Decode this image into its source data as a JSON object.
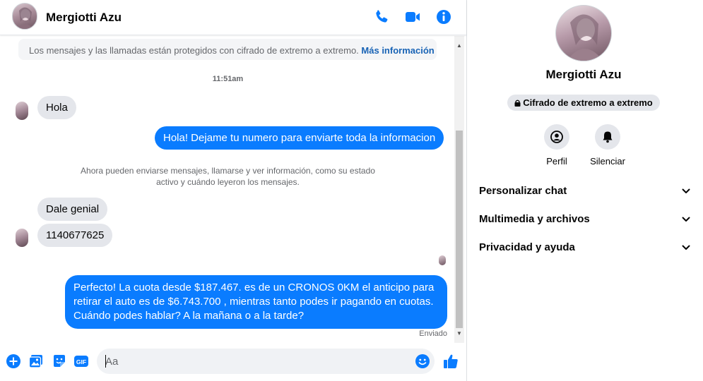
{
  "header": {
    "name": "Mergiotti Azu"
  },
  "chat": {
    "encryption_notice": "Los mensajes y las llamadas están protegidos con cifrado de extremo a extremo.",
    "encryption_link": "Más información",
    "timestamp": "11:51am",
    "messages": [
      {
        "from": "them",
        "text": "Hola"
      },
      {
        "from": "me",
        "text": "Hola! Dejame tu numero  para enviarte toda la informacion"
      },
      {
        "from": "system",
        "text": "Ahora pueden enviarse mensajes, llamarse y ver información, como su estado activo y cuándo leyeron los mensajes."
      },
      {
        "from": "them",
        "text": "Dale genial"
      },
      {
        "from": "them",
        "text": "1140677625"
      },
      {
        "from": "me",
        "text": "Perfecto! La cuota desde $187.467. es de un CRONOS 0KM el anticipo para retirar el auto es de $6.743.700 , mientras tanto podes ir pagando en cuotas. Cuándo podes hablar? A la mañana o a la tarde?"
      }
    ],
    "status": "Enviado"
  },
  "composer": {
    "placeholder": "Aa"
  },
  "panel": {
    "name": "Mergiotti Azu",
    "encryption_badge": "Cifrado de extremo a extremo",
    "actions": [
      "Perfil",
      "Silenciar"
    ],
    "sections": [
      "Personalizar chat",
      "Multimedia y archivos",
      "Privacidad y ayuda"
    ]
  },
  "colors": {
    "accent": "#0a7cff",
    "incoming_bubble": "#e4e6eb"
  },
  "icons": {
    "header": [
      "phone-icon",
      "video-camera-icon",
      "info-icon"
    ],
    "composer": [
      "plus-icon",
      "image-icon",
      "sticker-icon",
      "gif-icon",
      "emoji-icon",
      "thumbs-up-icon"
    ]
  }
}
